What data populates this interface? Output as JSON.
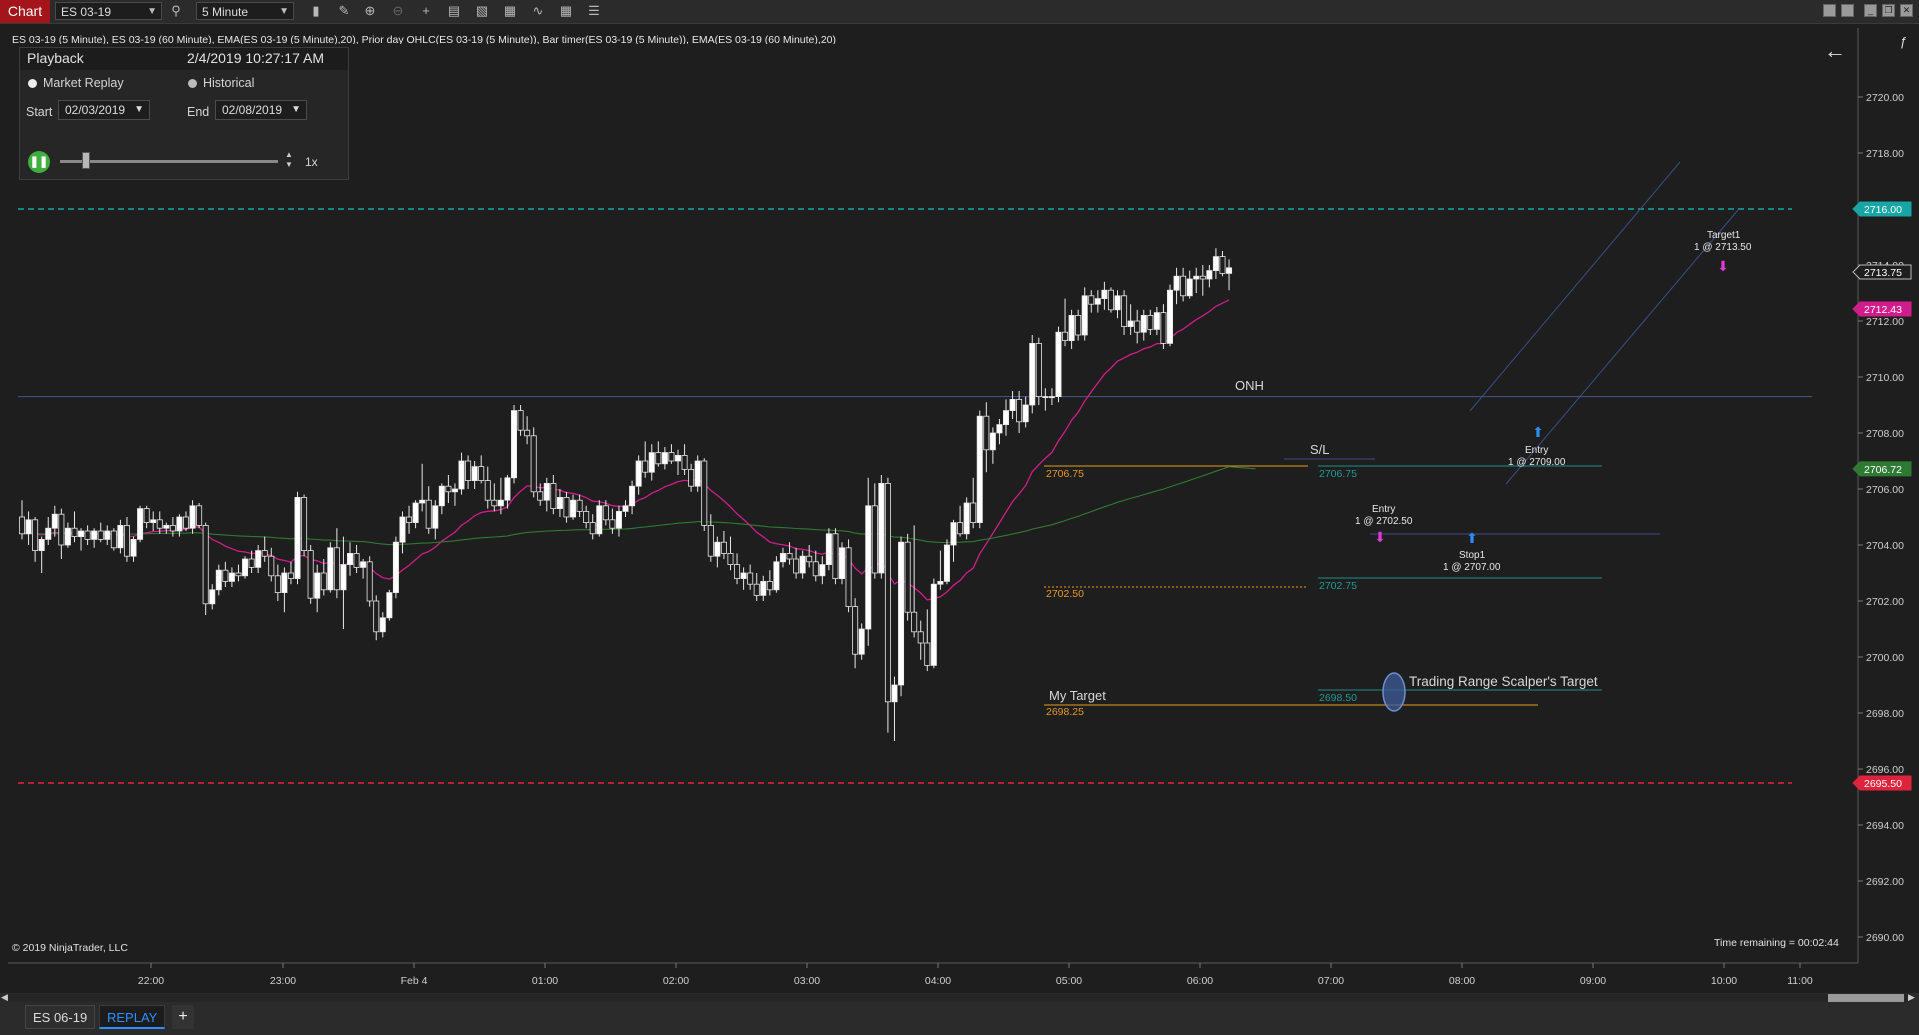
{
  "toolbar": {
    "chart_tab": "Chart",
    "instrument": "ES 03-19",
    "interval": "5 Minute",
    "icons": [
      "bar-chart-icon",
      "pencil-icon",
      "zoom-in-icon",
      "zoom-out-icon",
      "crosshair-icon",
      "properties-icon",
      "templates-icon",
      "strategies-icon",
      "drawing-tools-icon",
      "data-box-icon"
    ]
  },
  "indicator_line": "ES 03-19 (5 Minute), ES 03-19 (60 Minute), EMA(ES 03-19 (5 Minute),20), Prior day OHLC(ES 03-19 (5 Minute)), Bar timer(ES 03-19 (5 Minute)), EMA(ES 03-19 (60 Minute),20)",
  "playback": {
    "title": "Playback",
    "datetime": "2/4/2019 10:27:17 AM",
    "mode_market_replay": "Market Replay",
    "mode_historical": "Historical",
    "start_label": "Start",
    "start_value": "02/03/2019",
    "end_label": "End",
    "end_value": "02/08/2019",
    "speed": "1x"
  },
  "footer": {
    "copyright": "© 2019 NinjaTrader, LLC",
    "time_remaining": "Time remaining = 00:02:44"
  },
  "tabs": {
    "tab1": "ES 06-19",
    "tab2": "REPLAY",
    "add": "+"
  },
  "colors": {
    "up_candle": "#ffffff",
    "down_candle": "#f2f2f2",
    "ema5": "#d11d8b",
    "ema60": "#2f7a33",
    "prior_high": "#17a5a5",
    "prior_low": "#e0233c",
    "orange_level": "#e89a1e",
    "teal_level": "#1f8f8a",
    "channel": "#3a4f88"
  },
  "chart_data": {
    "type": "candlestick",
    "y_axis": {
      "ylim": [
        2689.5,
        2722.4
      ],
      "ticks": [
        "2720.00",
        "2718.00",
        "2716.00",
        "2714.00",
        "2712.00",
        "2710.00",
        "2708.00",
        "2706.00",
        "2704.00",
        "2702.00",
        "2700.00",
        "2698.00",
        "2696.00",
        "2694.00",
        "2692.00",
        "2690.00"
      ]
    },
    "x_axis": {
      "ticks": [
        "22:00",
        "23:00",
        "Feb 4",
        "01:00",
        "02:00",
        "03:00",
        "04:00",
        "05:00",
        "06:00",
        "07:00",
        "08:00",
        "09:00",
        "10:00",
        "11:00"
      ]
    },
    "price_markers": [
      {
        "label": "2716.00",
        "value": 2716.0,
        "color": "#17a5a5"
      },
      {
        "label": "2713.75",
        "value": 2713.75,
        "color": "#1e1e1e"
      },
      {
        "label": "2712.43",
        "value": 2712.43,
        "color": "#d11d8b"
      },
      {
        "label": "2706.72",
        "value": 2706.72,
        "color": "#2f7a33"
      },
      {
        "label": "2695.50",
        "value": 2695.5,
        "color": "#e0233c"
      }
    ],
    "levels": [
      {
        "name": "prior-day-high",
        "value": 2716.0,
        "style": "dashed",
        "color": "#17a5a5"
      },
      {
        "name": "prior-day-low",
        "value": 2695.5,
        "style": "dashed",
        "color": "#e0233c"
      },
      {
        "name": "onh",
        "value": 2709.3,
        "label": "ONH",
        "color": "#46588a"
      }
    ],
    "annotations": {
      "orange_top": "2706.75",
      "orange_mid": "2702.50",
      "orange_bottom": "2698.25",
      "my_target": "My Target",
      "sl_label": "S/L",
      "teal_top": "2706.75",
      "teal_mid": "2702.75",
      "teal_bottom": "2698.50",
      "range_target": "Trading Range Scalper's Target",
      "entry1_title": "Entry",
      "entry1_detail": "1 @ 2702.50",
      "stop1_title": "Stop1",
      "stop1_detail": "1 @ 2707.00",
      "entry2_title": "Entry",
      "entry2_detail": "1 @ 2709.00",
      "target1_title": "Target1",
      "target1_detail": "1 @ 2713.50"
    },
    "candles": [
      [
        2705.0,
        2705.6,
        2704.2,
        2704.4
      ],
      [
        2704.4,
        2705.2,
        2704.0,
        2704.9
      ],
      [
        2704.9,
        2705.0,
        2703.4,
        2703.8
      ],
      [
        2703.8,
        2704.3,
        2703.0,
        2704.2
      ],
      [
        2704.2,
        2705.0,
        2704.0,
        2704.6
      ],
      [
        2704.6,
        2705.4,
        2704.3,
        2705.1
      ],
      [
        2705.1,
        2705.3,
        2703.5,
        2704.0
      ],
      [
        2704.0,
        2704.8,
        2703.9,
        2704.6
      ],
      [
        2704.6,
        2705.2,
        2704.1,
        2704.3
      ],
      [
        2704.3,
        2704.6,
        2703.8,
        2704.5
      ],
      [
        2704.5,
        2704.7,
        2704.0,
        2704.2
      ],
      [
        2704.2,
        2704.6,
        2703.9,
        2704.5
      ],
      [
        2704.5,
        2704.8,
        2704.1,
        2704.2
      ],
      [
        2704.2,
        2704.7,
        2704.0,
        2704.5
      ],
      [
        2704.5,
        2704.6,
        2703.8,
        2703.9
      ],
      [
        2703.9,
        2704.9,
        2703.7,
        2704.7
      ],
      [
        2704.7,
        2705.0,
        2703.4,
        2703.6
      ],
      [
        2703.6,
        2704.3,
        2703.4,
        2704.2
      ],
      [
        2704.2,
        2705.4,
        2704.1,
        2705.3
      ],
      [
        2705.3,
        2705.4,
        2704.6,
        2704.8
      ],
      [
        2704.8,
        2705.2,
        2704.5,
        2704.9
      ],
      [
        2704.9,
        2705.2,
        2704.4,
        2704.6
      ],
      [
        2704.6,
        2704.8,
        2704.4,
        2704.7
      ],
      [
        2704.7,
        2705.0,
        2704.3,
        2704.5
      ],
      [
        2704.5,
        2705.1,
        2704.3,
        2705.0
      ],
      [
        2705.0,
        2705.2,
        2704.5,
        2704.6
      ],
      [
        2704.6,
        2705.6,
        2704.4,
        2705.4
      ],
      [
        2705.4,
        2705.5,
        2704.6,
        2704.7
      ],
      [
        2704.7,
        2704.8,
        2701.5,
        2701.9
      ],
      [
        2701.9,
        2702.6,
        2701.7,
        2702.4
      ],
      [
        2702.4,
        2703.3,
        2702.2,
        2703.1
      ],
      [
        2703.1,
        2703.4,
        2702.5,
        2702.7
      ],
      [
        2702.7,
        2703.2,
        2702.5,
        2703.0
      ],
      [
        2703.0,
        2703.3,
        2702.7,
        2702.9
      ],
      [
        2702.9,
        2703.6,
        2702.8,
        2703.5
      ],
      [
        2703.5,
        2703.8,
        2703.0,
        2703.2
      ],
      [
        2703.2,
        2704.0,
        2703.0,
        2703.8
      ],
      [
        2703.8,
        2704.3,
        2703.4,
        2703.6
      ],
      [
        2703.6,
        2703.9,
        2702.7,
        2702.9
      ],
      [
        2702.9,
        2703.3,
        2702.0,
        2702.3
      ],
      [
        2702.3,
        2703.2,
        2701.6,
        2703.0
      ],
      [
        2703.0,
        2703.4,
        2702.6,
        2702.8
      ],
      [
        2702.8,
        2705.9,
        2702.6,
        2705.7
      ],
      [
        2705.7,
        2705.8,
        2703.6,
        2703.8
      ],
      [
        2703.8,
        2704.0,
        2701.9,
        2702.1
      ],
      [
        2702.1,
        2703.3,
        2701.6,
        2703.0
      ],
      [
        2703.0,
        2703.5,
        2702.2,
        2702.4
      ],
      [
        2702.4,
        2704.1,
        2702.3,
        2703.9
      ],
      [
        2703.9,
        2704.6,
        2702.1,
        2702.4
      ],
      [
        2702.4,
        2704.3,
        2701.0,
        2703.3
      ],
      [
        2703.3,
        2704.1,
        2702.9,
        2703.7
      ],
      [
        2703.7,
        2704.0,
        2703.0,
        2703.2
      ],
      [
        2703.2,
        2703.5,
        2702.8,
        2703.4
      ],
      [
        2703.4,
        2703.6,
        2701.8,
        2702.0
      ],
      [
        2702.0,
        2702.2,
        2700.6,
        2700.9
      ],
      [
        2700.9,
        2701.6,
        2700.7,
        2701.4
      ],
      [
        2701.4,
        2702.4,
        2701.3,
        2702.3
      ],
      [
        2702.3,
        2704.3,
        2702.1,
        2704.1
      ],
      [
        2704.1,
        2705.2,
        2703.7,
        2705.0
      ],
      [
        2705.0,
        2705.4,
        2704.4,
        2704.8
      ],
      [
        2704.8,
        2705.6,
        2704.6,
        2705.5
      ],
      [
        2705.5,
        2706.9,
        2705.2,
        2705.6
      ],
      [
        2705.6,
        2706.1,
        2704.4,
        2704.6
      ],
      [
        2704.6,
        2705.6,
        2704.2,
        2705.4
      ],
      [
        2705.4,
        2706.2,
        2705.1,
        2706.1
      ],
      [
        2706.1,
        2706.5,
        2705.5,
        2705.9
      ],
      [
        2705.9,
        2706.2,
        2705.4,
        2706.0
      ],
      [
        2706.0,
        2707.3,
        2705.8,
        2707.0
      ],
      [
        2707.0,
        2707.2,
        2706.0,
        2706.3
      ],
      [
        2706.3,
        2707.0,
        2706.0,
        2706.8
      ],
      [
        2706.8,
        2707.2,
        2706.2,
        2706.3
      ],
      [
        2706.3,
        2706.8,
        2705.3,
        2705.6
      ],
      [
        2705.6,
        2706.2,
        2705.2,
        2705.4
      ],
      [
        2705.4,
        2706.4,
        2705.1,
        2705.6
      ],
      [
        2705.6,
        2706.5,
        2705.3,
        2706.4
      ],
      [
        2706.4,
        2709.0,
        2706.2,
        2708.8
      ],
      [
        2708.8,
        2709.0,
        2707.9,
        2708.1
      ],
      [
        2708.1,
        2708.6,
        2707.6,
        2707.9
      ],
      [
        2707.9,
        2708.2,
        2705.7,
        2705.9
      ],
      [
        2705.9,
        2706.2,
        2705.4,
        2705.6
      ],
      [
        2705.6,
        2706.4,
        2705.2,
        2706.2
      ],
      [
        2706.2,
        2706.5,
        2705.1,
        2705.3
      ],
      [
        2705.3,
        2706.0,
        2705.0,
        2705.7
      ],
      [
        2705.7,
        2705.9,
        2704.8,
        2705.0
      ],
      [
        2705.0,
        2705.8,
        2704.9,
        2705.6
      ],
      [
        2705.6,
        2705.8,
        2705.0,
        2705.2
      ],
      [
        2705.2,
        2705.4,
        2704.6,
        2704.8
      ],
      [
        2704.8,
        2705.1,
        2704.2,
        2704.4
      ],
      [
        2704.4,
        2705.6,
        2704.3,
        2705.4
      ],
      [
        2705.4,
        2705.6,
        2704.7,
        2704.9
      ],
      [
        2704.9,
        2705.3,
        2704.4,
        2704.6
      ],
      [
        2704.6,
        2705.4,
        2704.3,
        2705.2
      ],
      [
        2705.2,
        2705.6,
        2705.0,
        2705.4
      ],
      [
        2705.4,
        2706.3,
        2705.1,
        2706.1
      ],
      [
        2706.1,
        2707.2,
        2705.8,
        2707.0
      ],
      [
        2707.0,
        2707.7,
        2706.4,
        2706.6
      ],
      [
        2706.6,
        2707.6,
        2706.3,
        2707.3
      ],
      [
        2707.3,
        2707.7,
        2706.8,
        2706.9
      ],
      [
        2706.9,
        2707.5,
        2706.7,
        2707.3
      ],
      [
        2707.3,
        2707.6,
        2706.9,
        2707.0
      ],
      [
        2707.0,
        2707.4,
        2706.5,
        2707.2
      ],
      [
        2707.2,
        2707.6,
        2706.5,
        2706.7
      ],
      [
        2706.7,
        2706.9,
        2705.9,
        2706.1
      ],
      [
        2706.1,
        2707.2,
        2705.9,
        2707.0
      ],
      [
        2707.0,
        2707.1,
        2704.5,
        2704.7
      ],
      [
        2704.7,
        2705.1,
        2703.4,
        2703.6
      ],
      [
        2703.6,
        2704.3,
        2703.2,
        2704.1
      ],
      [
        2704.1,
        2704.5,
        2703.5,
        2703.7
      ],
      [
        2703.7,
        2704.3,
        2703.1,
        2703.3
      ],
      [
        2703.3,
        2703.7,
        2702.6,
        2702.8
      ],
      [
        2702.8,
        2703.2,
        2702.4,
        2703.0
      ],
      [
        2703.0,
        2703.3,
        2702.4,
        2702.6
      ],
      [
        2702.6,
        2703.0,
        2702.0,
        2702.2
      ],
      [
        2702.2,
        2702.9,
        2702.0,
        2702.7
      ],
      [
        2702.7,
        2703.1,
        2702.2,
        2702.4
      ],
      [
        2702.4,
        2703.6,
        2702.3,
        2703.4
      ],
      [
        2703.4,
        2703.9,
        2703.2,
        2703.7
      ],
      [
        2703.7,
        2704.1,
        2703.3,
        2703.5
      ],
      [
        2703.5,
        2703.9,
        2702.8,
        2703.0
      ],
      [
        2703.0,
        2703.8,
        2702.8,
        2703.6
      ],
      [
        2703.6,
        2704.0,
        2703.2,
        2703.4
      ],
      [
        2703.4,
        2703.8,
        2702.7,
        2702.9
      ],
      [
        2702.9,
        2703.6,
        2702.6,
        2703.3
      ],
      [
        2703.3,
        2704.6,
        2703.1,
        2704.4
      ],
      [
        2704.4,
        2704.6,
        2702.6,
        2702.8
      ],
      [
        2702.8,
        2704.1,
        2702.6,
        2703.9
      ],
      [
        2703.9,
        2704.2,
        2701.6,
        2701.8
      ],
      [
        2701.8,
        2702.1,
        2699.6,
        2700.1
      ],
      [
        2700.1,
        2701.2,
        2699.9,
        2701.0
      ],
      [
        2701.0,
        2706.4,
        2700.4,
        2705.4
      ],
      [
        2705.4,
        2706.2,
        2702.8,
        2703.0
      ],
      [
        2703.0,
        2706.5,
        2702.8,
        2706.2
      ],
      [
        2706.2,
        2706.4,
        2697.3,
        2698.4
      ],
      [
        2698.4,
        2699.3,
        2697.0,
        2699.0
      ],
      [
        2699.0,
        2704.3,
        2698.6,
        2704.1
      ],
      [
        2704.1,
        2704.4,
        2701.3,
        2701.6
      ],
      [
        2701.6,
        2704.7,
        2700.7,
        2700.9
      ],
      [
        2700.9,
        2701.3,
        2699.9,
        2700.5
      ],
      [
        2700.5,
        2701.7,
        2699.5,
        2699.7
      ],
      [
        2699.7,
        2702.8,
        2699.6,
        2702.6
      ],
      [
        2702.6,
        2703.8,
        2702.4,
        2702.7
      ],
      [
        2702.7,
        2704.2,
        2702.6,
        2704.0
      ],
      [
        2704.0,
        2704.9,
        2703.4,
        2704.8
      ],
      [
        2704.8,
        2705.4,
        2704.3,
        2704.4
      ],
      [
        2704.4,
        2705.7,
        2704.2,
        2705.5
      ],
      [
        2705.5,
        2706.4,
        2704.6,
        2704.8
      ],
      [
        2704.8,
        2708.8,
        2704.6,
        2708.6
      ],
      [
        2708.6,
        2709.1,
        2706.6,
        2707.4
      ],
      [
        2707.4,
        2708.2,
        2706.9,
        2708.0
      ],
      [
        2708.0,
        2708.5,
        2707.6,
        2708.3
      ],
      [
        2708.3,
        2709.2,
        2707.9,
        2708.8
      ],
      [
        2708.8,
        2709.5,
        2708.5,
        2709.2
      ],
      [
        2709.2,
        2709.5,
        2708.0,
        2708.4
      ],
      [
        2708.4,
        2709.3,
        2708.2,
        2709.0
      ],
      [
        2709.0,
        2711.5,
        2708.7,
        2711.2
      ],
      [
        2711.2,
        2711.4,
        2709.0,
        2709.3
      ],
      [
        2709.3,
        2709.6,
        2708.8,
        2709.3
      ],
      [
        2709.3,
        2709.6,
        2709.0,
        2709.3
      ],
      [
        2709.3,
        2711.8,
        2709.1,
        2711.6
      ],
      [
        2711.6,
        2712.8,
        2711.1,
        2711.3
      ],
      [
        2711.3,
        2712.4,
        2711.0,
        2712.2
      ],
      [
        2712.2,
        2712.4,
        2711.3,
        2711.5
      ],
      [
        2711.5,
        2713.2,
        2711.3,
        2712.9
      ],
      [
        2712.9,
        2713.1,
        2712.3,
        2712.6
      ],
      [
        2712.6,
        2713.1,
        2712.3,
        2712.8
      ],
      [
        2712.8,
        2713.4,
        2712.4,
        2713.1
      ],
      [
        2713.1,
        2713.2,
        2712.3,
        2712.4
      ],
      [
        2712.4,
        2713.1,
        2712.1,
        2712.9
      ],
      [
        2712.9,
        2713.1,
        2711.5,
        2711.8
      ],
      [
        2711.8,
        2712.6,
        2711.5,
        2712.0
      ],
      [
        2712.0,
        2712.4,
        2711.2,
        2711.6
      ],
      [
        2711.6,
        2712.4,
        2711.3,
        2712.2
      ],
      [
        2712.2,
        2712.4,
        2711.5,
        2711.7
      ],
      [
        2711.7,
        2712.5,
        2711.5,
        2712.3
      ],
      [
        2712.3,
        2712.6,
        2711.0,
        2711.2
      ],
      [
        2711.2,
        2713.3,
        2711.1,
        2713.1
      ],
      [
        2713.1,
        2713.9,
        2712.6,
        2713.6
      ],
      [
        2713.6,
        2713.9,
        2712.7,
        2712.9
      ],
      [
        2712.9,
        2713.8,
        2712.8,
        2713.5
      ],
      [
        2713.5,
        2713.9,
        2713.0,
        2713.6
      ],
      [
        2713.6,
        2714.0,
        2712.9,
        2713.5
      ],
      [
        2713.5,
        2714.0,
        2713.2,
        2713.8
      ],
      [
        2713.8,
        2714.6,
        2713.5,
        2714.3
      ],
      [
        2714.3,
        2714.5,
        2713.6,
        2713.7
      ],
      [
        2713.7,
        2714.2,
        2713.1,
        2713.9
      ]
    ]
  }
}
